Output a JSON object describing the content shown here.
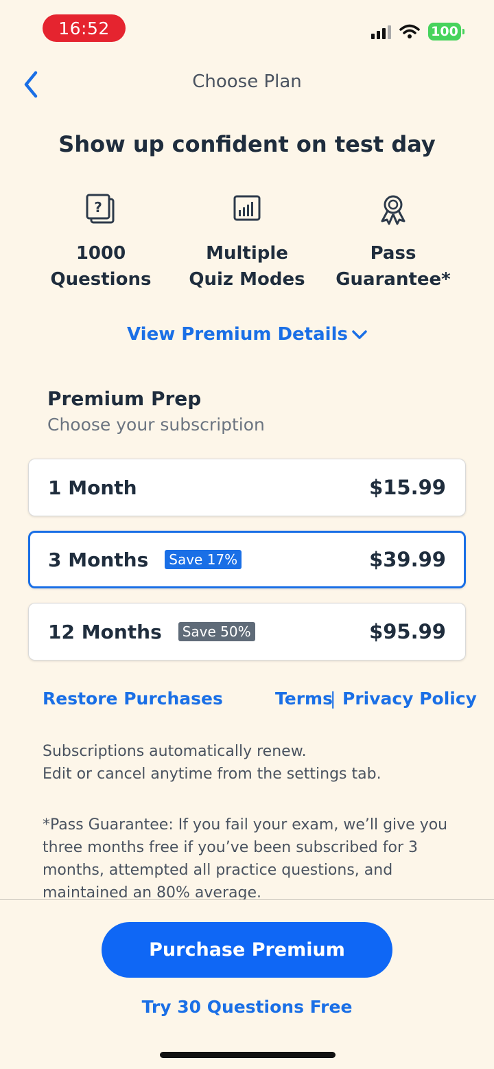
{
  "status_bar": {
    "time": "16:52",
    "battery": "100"
  },
  "nav": {
    "title": "Choose Plan"
  },
  "headline": "Show up confident on test day",
  "features": [
    {
      "icon": "question-cards-icon",
      "line1": "1000",
      "line2": "Questions"
    },
    {
      "icon": "bar-chart-icon",
      "line1": "Multiple",
      "line2": "Quiz Modes"
    },
    {
      "icon": "award-ribbon-icon",
      "line1": "Pass",
      "line2": "Guarantee*"
    }
  ],
  "view_details": "View Premium Details",
  "section": {
    "title": "Premium Prep",
    "subtitle": "Choose your subscription"
  },
  "plans": [
    {
      "name": "1 Month",
      "badge": "",
      "price": "$15.99",
      "selected": false
    },
    {
      "name": "3 Months",
      "badge": "Save 17%",
      "price": "$39.99",
      "selected": true
    },
    {
      "name": "12 Months",
      "badge": "Save 50%",
      "price": "$95.99",
      "selected": false
    }
  ],
  "links": {
    "restore": "Restore Purchases",
    "terms": "Terms",
    "separator": "|",
    "privacy": "Privacy Policy"
  },
  "fine_print": {
    "renew_line1": "Subscriptions automatically renew.",
    "renew_line2": "Edit or cancel anytime from the settings tab.",
    "guarantee": "*Pass Guarantee: If you fail your exam, we’ll give you three months free if you’ve been subscribed for 3 months, attempted all practice questions, and maintained an 80% average."
  },
  "cta": {
    "purchase": "Purchase Premium",
    "try_free": "Try 30 Questions Free"
  },
  "colors": {
    "accent": "#1a6fe6",
    "button": "#0f67f5",
    "background": "#fdf6e9",
    "badge_selected": "#1a6fe6",
    "badge_other": "#5f6b78",
    "time_pill": "#e5242f",
    "battery": "#47d35c"
  }
}
